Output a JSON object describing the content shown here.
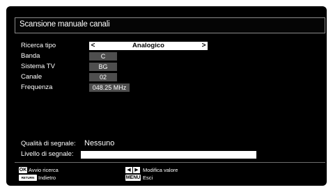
{
  "title": "Scansione manuale canali",
  "fields": {
    "search_type": {
      "label": "Ricerca tipo",
      "value": "Analogico",
      "left_arrow": "<",
      "right_arrow": ">"
    },
    "band": {
      "label": "Banda",
      "value": "C"
    },
    "tv_system": {
      "label": "Sistema TV",
      "value": "BG"
    },
    "channel": {
      "label": "Canale",
      "value": "02"
    },
    "frequency": {
      "label": "Frequenza",
      "value": "048.25 MHz"
    }
  },
  "signal": {
    "quality_label": "Qualità di segnale:",
    "quality_value": "Nessuno",
    "level_label": "Livello di segnale:",
    "level_fraction": 1.0
  },
  "help": {
    "ok_key": "OK",
    "ok_text": "Avvio ricerca",
    "return_key": "RETURN",
    "return_text": "Indietro",
    "arrows_text": "Modifica valore",
    "menu_key": "MENU",
    "menu_text": "Esci"
  },
  "colors": {
    "background": "#000000",
    "value_box": "#4e4e4e",
    "selector": "#ffffff",
    "text": "#ffffff"
  },
  "icons": {
    "left_arrow": "left-arrow-icon",
    "right_arrow": "right-arrow-icon"
  }
}
